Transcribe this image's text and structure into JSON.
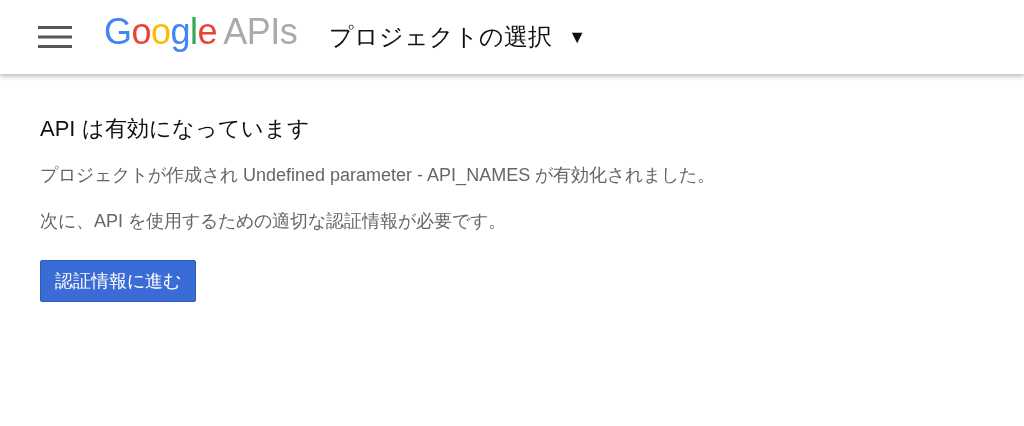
{
  "header": {
    "logo": {
      "brand": "Google",
      "product": "APIs"
    },
    "project_selector": {
      "label": "プロジェクトの選択",
      "arrow": "▼"
    }
  },
  "content": {
    "title": "API は有効になっています",
    "paragraphs": [
      "プロジェクトが作成され Undefined parameter - API_NAMES が有効化されました。",
      "次に、API を使用するための適切な認証情報が必要です。"
    ],
    "button": "認証情報に進む"
  }
}
